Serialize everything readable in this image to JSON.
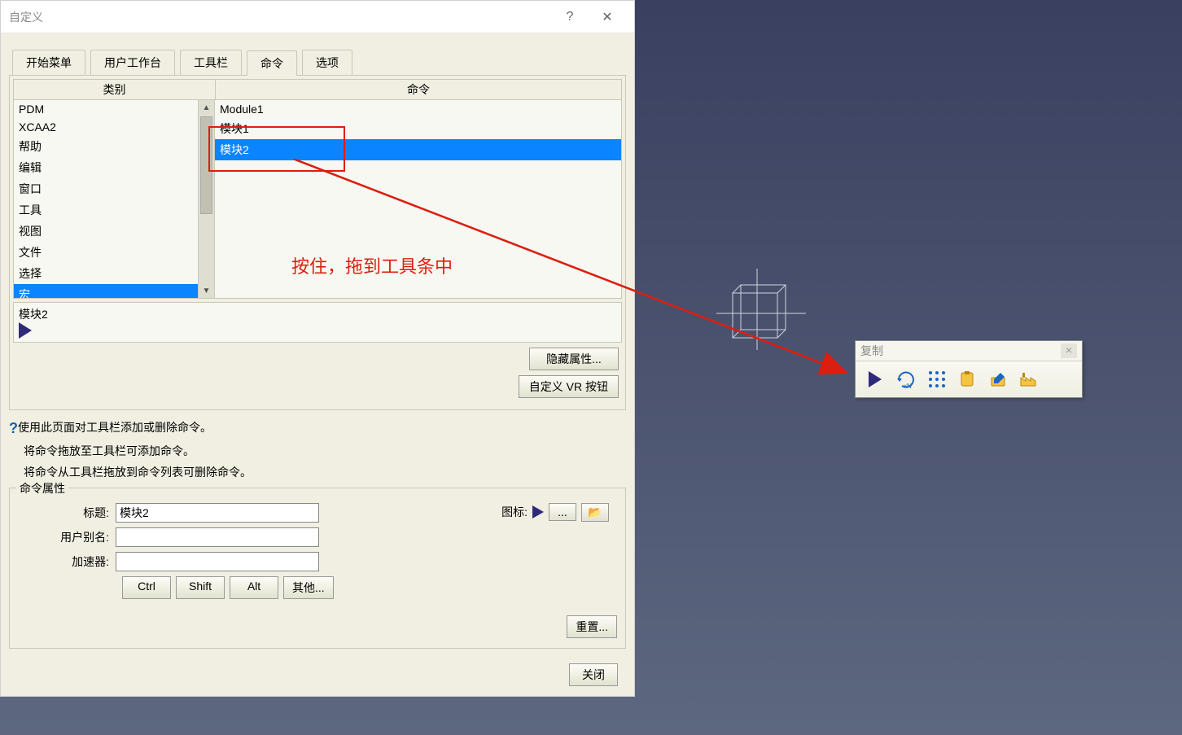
{
  "dialog": {
    "title": "自定义",
    "tabs": [
      "开始菜单",
      "用户工作台",
      "工具栏",
      "命令",
      "选项"
    ],
    "active_tab": "命令",
    "headers": {
      "category": "类别",
      "command": "命令"
    },
    "categories": [
      "PDM",
      "XCAA2",
      "帮助",
      "编辑",
      "窗口",
      "工具",
      "视图",
      "文件",
      "选择",
      "宏"
    ],
    "selected_category": "宏",
    "commands": [
      "Module1",
      "模块1",
      "模块2"
    ],
    "selected_command": "模块2",
    "preview_label": "模块2",
    "buttons": {
      "hide_props": "隐藏属性...",
      "vr_btn": "自定义 VR 按钮",
      "reset": "重置...",
      "close": "关闭"
    },
    "help_lines": [
      "使用此页面对工具栏添加或删除命令。",
      "将命令拖放至工具栏可添加命令。",
      "将命令从工具栏拖放到命令列表可删除命令。"
    ],
    "props_group": "命令属性",
    "labels": {
      "title": "标题:",
      "alias": "用户别名:",
      "accel": "加速器:",
      "icon": "图标:"
    },
    "values": {
      "title": "模块2",
      "alias": "",
      "accel": ""
    },
    "mod_keys": [
      "Ctrl",
      "Shift",
      "Alt",
      "其他..."
    ],
    "icon_buttons": {
      "dots": "...",
      "open": "📂"
    }
  },
  "annotation": {
    "text": "按住，拖到工具条中"
  },
  "float_toolbar": {
    "title": "复制"
  }
}
